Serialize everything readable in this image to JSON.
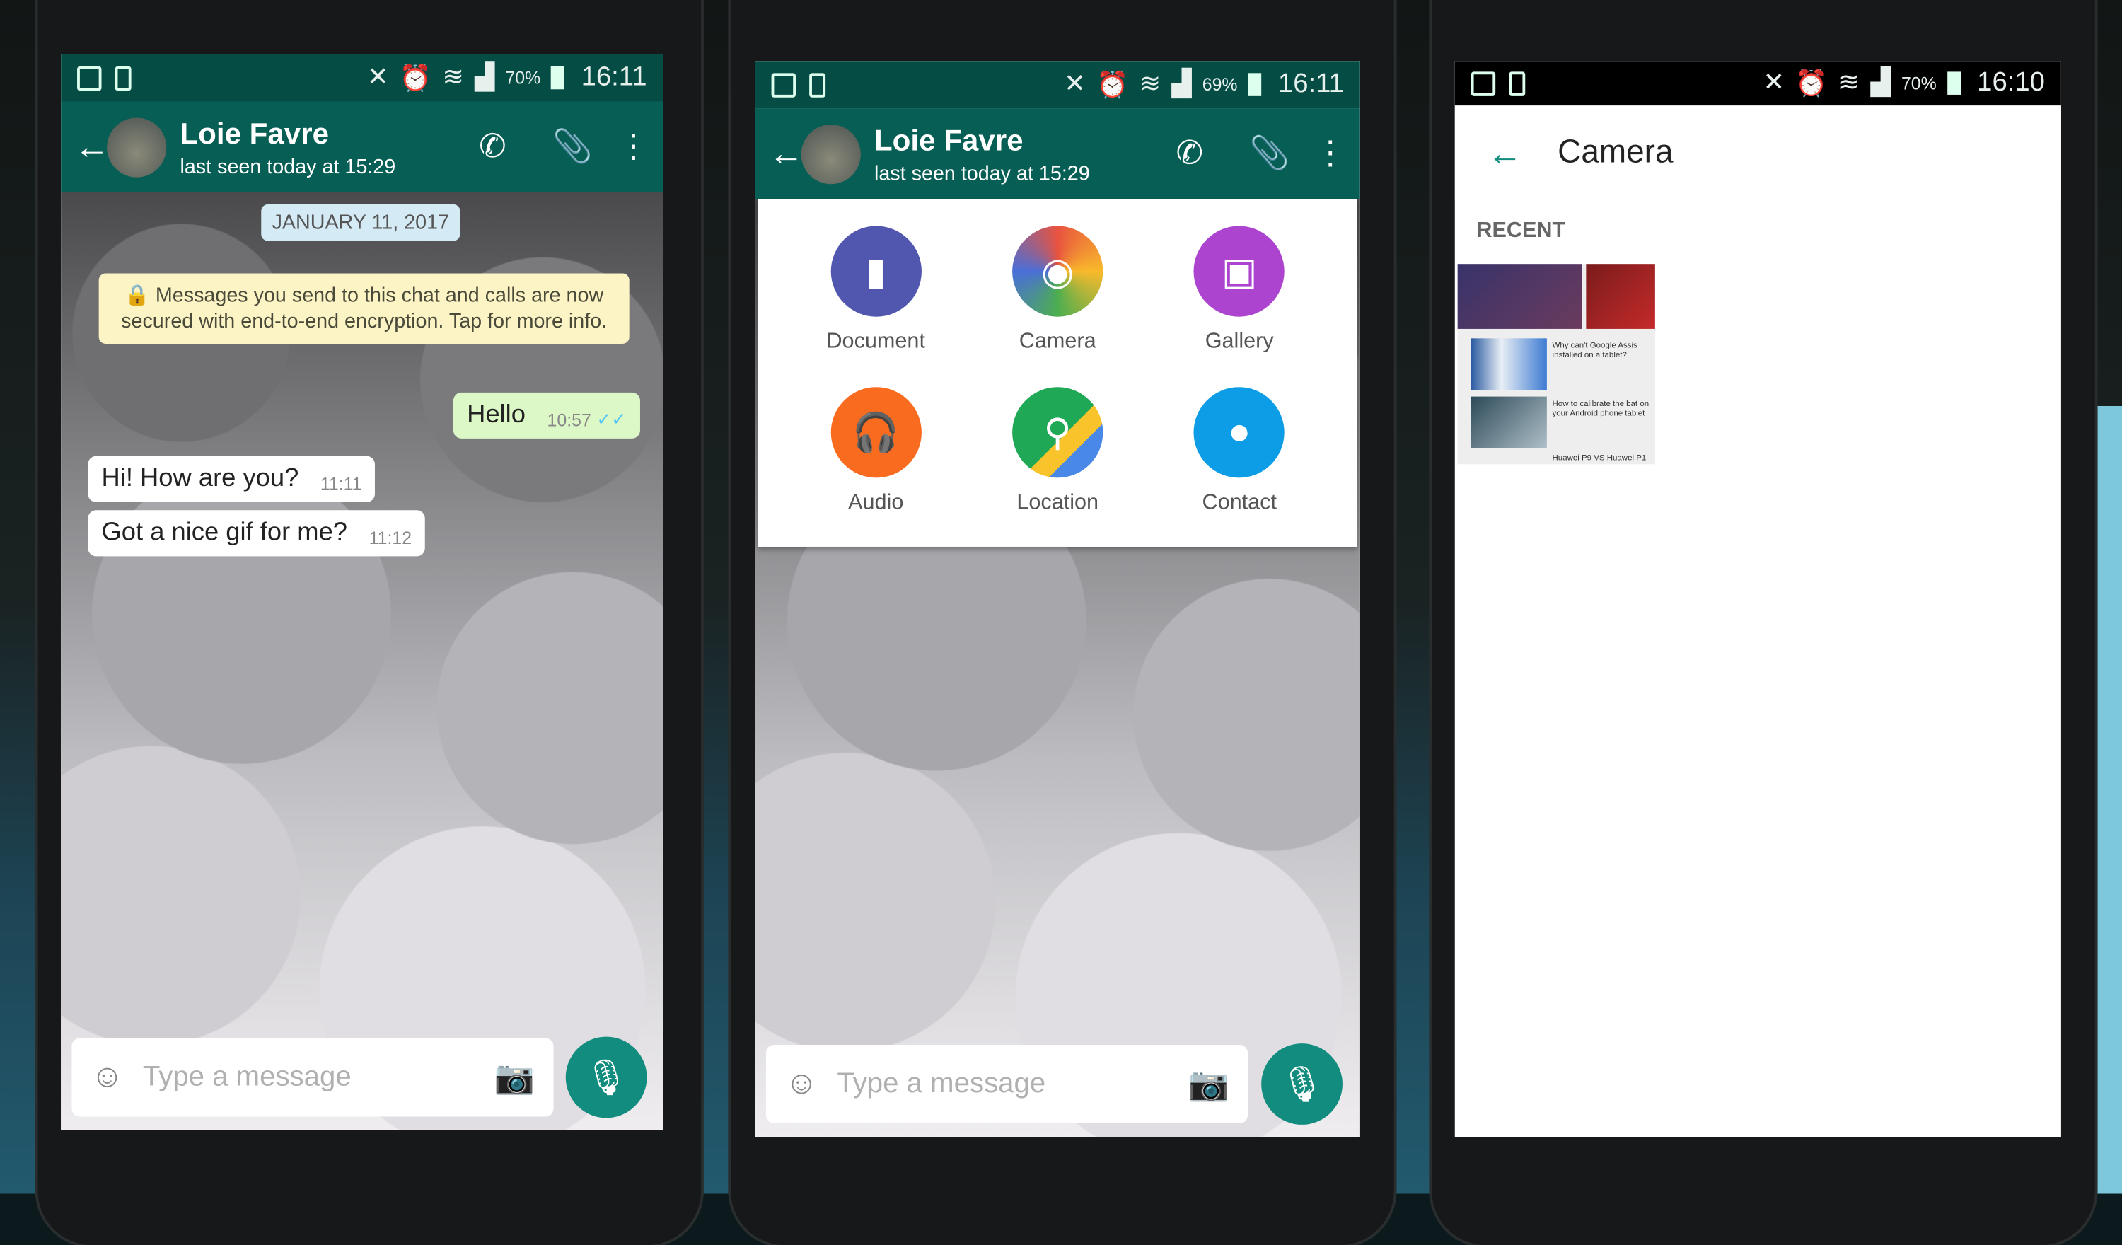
{
  "phones": [
    {
      "status": {
        "battery": "70%",
        "time": "16:11"
      },
      "header": {
        "name": "Loie Favre",
        "last_seen": "last seen today at 15:29"
      },
      "chat": {
        "date": "JANUARY 11, 2017",
        "encryption_notice": "Messages you send to this chat and calls are now secured with end-to-end encryption. Tap for more info.",
        "messages": [
          {
            "text": "Hello",
            "time": "10:57",
            "direction": "outgoing",
            "read": true
          },
          {
            "text": "Hi! How are you?",
            "time": "11:11",
            "direction": "incoming"
          },
          {
            "text": "Got a nice gif for me?",
            "time": "11:12",
            "direction": "incoming"
          }
        ]
      },
      "input": {
        "placeholder": "Type a message"
      }
    },
    {
      "status": {
        "battery": "69%",
        "time": "16:11"
      },
      "header": {
        "name": "Loie Favre",
        "last_seen": "last seen today at 15:29"
      },
      "attach_menu": [
        {
          "label": "Document",
          "color": "#5157ae",
          "icon": "document-icon"
        },
        {
          "label": "Camera",
          "color": "#e8533f",
          "icon": "camera-icon"
        },
        {
          "label": "Gallery",
          "color": "#ac44cf",
          "icon": "gallery-icon"
        },
        {
          "label": "Audio",
          "color": "#f96b1e",
          "icon": "headphones-icon"
        },
        {
          "label": "Location",
          "color": "#1fa855",
          "icon": "location-icon"
        },
        {
          "label": "Contact",
          "color": "#0d9de6",
          "icon": "contact-icon"
        }
      ],
      "input": {
        "placeholder": "Type a message"
      }
    },
    {
      "status": {
        "battery": "70%",
        "time": "16:10"
      },
      "title": "Camera",
      "section": "RECENT",
      "thumbnail_texts": [
        "Why can't Google Assis installed on a tablet?",
        "How to calibrate the bat on your Android phone tablet",
        "Huawei P9 VS Huawei P1"
      ]
    }
  ],
  "colors": {
    "header": "#075e54",
    "accent": "#128c7e",
    "outgoing": "#dcf8c6"
  }
}
